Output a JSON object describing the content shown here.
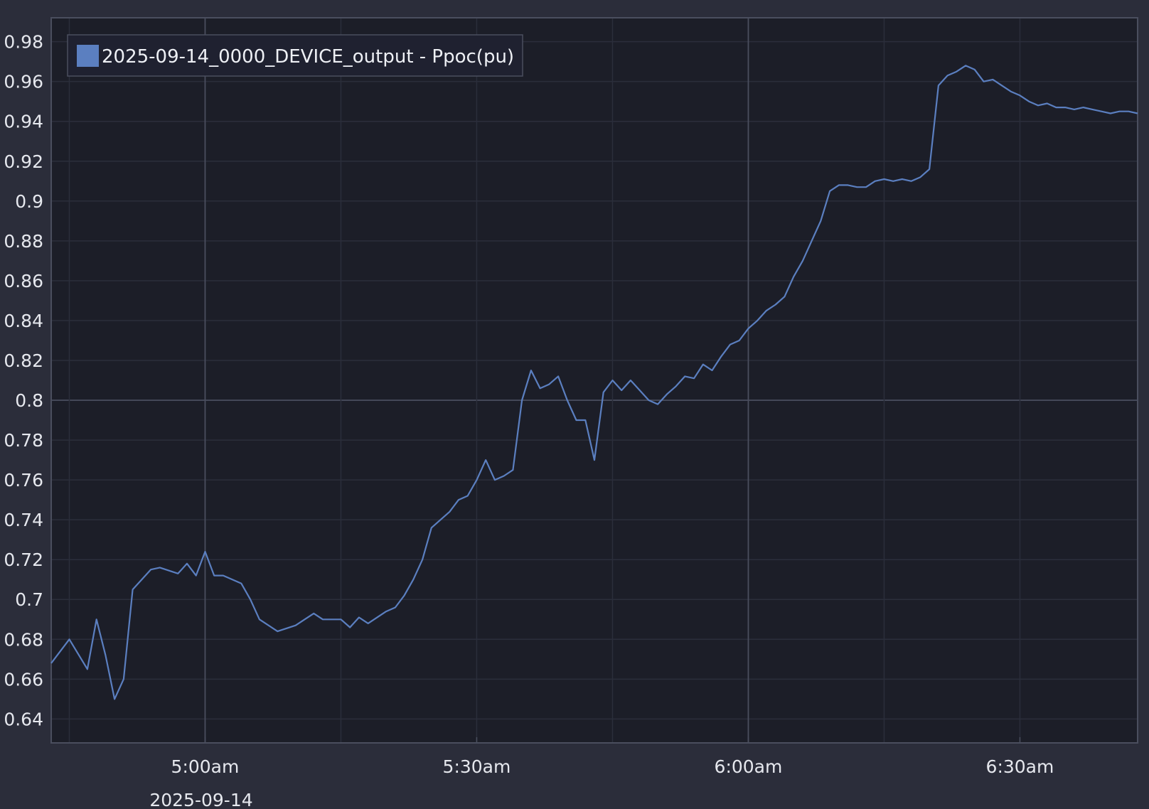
{
  "chart_data": {
    "type": "line",
    "title": "",
    "xlabel": "",
    "ylabel": "",
    "date_label": "2025-09-14",
    "x_unit": "time of day",
    "xlim": [
      "04:43",
      "06:43"
    ],
    "ylim": [
      0.628,
      0.992
    ],
    "y_ticks": [
      "0.64",
      "0.66",
      "0.68",
      "0.7",
      "0.72",
      "0.74",
      "0.76",
      "0.78",
      "0.8",
      "0.82",
      "0.84",
      "0.86",
      "0.88",
      "0.9",
      "0.92",
      "0.94",
      "0.96",
      "0.98"
    ],
    "x_ticks": [
      {
        "time": "05:00",
        "label": "5:00am"
      },
      {
        "time": "05:30",
        "label": "5:30am"
      },
      {
        "time": "06:00",
        "label": "6:00am"
      },
      {
        "time": "06:30",
        "label": "6:30am"
      }
    ],
    "grid": true,
    "legend_position": "top-left",
    "colors": {
      "background": "#2b2d3a",
      "plot_background": "#1c1e28",
      "grid": "#2b2e3b",
      "axis_line": "#4a4e5e",
      "series": "#5b7fc0",
      "text": "#e6e8ee"
    },
    "series": [
      {
        "name": "2025-09-14_0000_DEVICE_output - Ppoc(pu)",
        "color": "#5b7fc0",
        "x": [
          "04:43",
          "04:45",
          "04:47",
          "04:48",
          "04:49",
          "04:50",
          "04:51",
          "04:52",
          "04:54",
          "04:55",
          "04:57",
          "04:58",
          "04:59",
          "05:00",
          "05:01",
          "05:02",
          "05:04",
          "05:05",
          "05:06",
          "05:08",
          "05:10",
          "05:11",
          "05:12",
          "05:13",
          "05:15",
          "05:16",
          "05:17",
          "05:18",
          "05:20",
          "05:21",
          "05:22",
          "05:23",
          "05:24",
          "05:25",
          "05:26",
          "05:27",
          "05:28",
          "05:29",
          "05:30",
          "05:31",
          "05:32",
          "05:33",
          "05:34",
          "05:35",
          "05:36",
          "05:37",
          "05:38",
          "05:39",
          "05:40",
          "05:41",
          "05:42",
          "05:43",
          "05:44",
          "05:45",
          "05:46",
          "05:47",
          "05:48",
          "05:49",
          "05:50",
          "05:51",
          "05:52",
          "05:53",
          "05:54",
          "05:55",
          "05:56",
          "05:57",
          "05:58",
          "05:59",
          "06:00",
          "06:01",
          "06:02",
          "06:03",
          "06:04",
          "06:05",
          "06:06",
          "06:07",
          "06:08",
          "06:09",
          "06:10",
          "06:11",
          "06:12",
          "06:13",
          "06:14",
          "06:15",
          "06:16",
          "06:17",
          "06:18",
          "06:19",
          "06:20",
          "06:21",
          "06:22",
          "06:23",
          "06:24",
          "06:25",
          "06:26",
          "06:27",
          "06:28",
          "06:29",
          "06:30",
          "06:31",
          "06:32",
          "06:33",
          "06:34",
          "06:35",
          "06:36",
          "06:37",
          "06:38",
          "06:39",
          "06:40",
          "06:41",
          "06:42",
          "06:43"
        ],
        "y": [
          0.668,
          0.68,
          0.665,
          0.69,
          0.672,
          0.65,
          0.66,
          0.705,
          0.715,
          0.716,
          0.713,
          0.718,
          0.712,
          0.724,
          0.712,
          0.712,
          0.708,
          0.7,
          0.69,
          0.684,
          0.687,
          0.69,
          0.693,
          0.69,
          0.69,
          0.686,
          0.691,
          0.688,
          0.694,
          0.696,
          0.702,
          0.71,
          0.72,
          0.736,
          0.74,
          0.744,
          0.75,
          0.752,
          0.76,
          0.77,
          0.76,
          0.762,
          0.765,
          0.8,
          0.815,
          0.806,
          0.808,
          0.812,
          0.8,
          0.79,
          0.79,
          0.77,
          0.804,
          0.81,
          0.805,
          0.81,
          0.805,
          0.8,
          0.798,
          0.803,
          0.807,
          0.812,
          0.811,
          0.818,
          0.815,
          0.822,
          0.828,
          0.83,
          0.836,
          0.84,
          0.845,
          0.848,
          0.852,
          0.862,
          0.87,
          0.88,
          0.89,
          0.905,
          0.908,
          0.908,
          0.907,
          0.907,
          0.91,
          0.911,
          0.91,
          0.911,
          0.91,
          0.912,
          0.916,
          0.958,
          0.963,
          0.965,
          0.968,
          0.966,
          0.96,
          0.961,
          0.958,
          0.955,
          0.953,
          0.95,
          0.948,
          0.949,
          0.947,
          0.947,
          0.946,
          0.947,
          0.946,
          0.945,
          0.944,
          0.945,
          0.945,
          0.944
        ]
      }
    ]
  }
}
